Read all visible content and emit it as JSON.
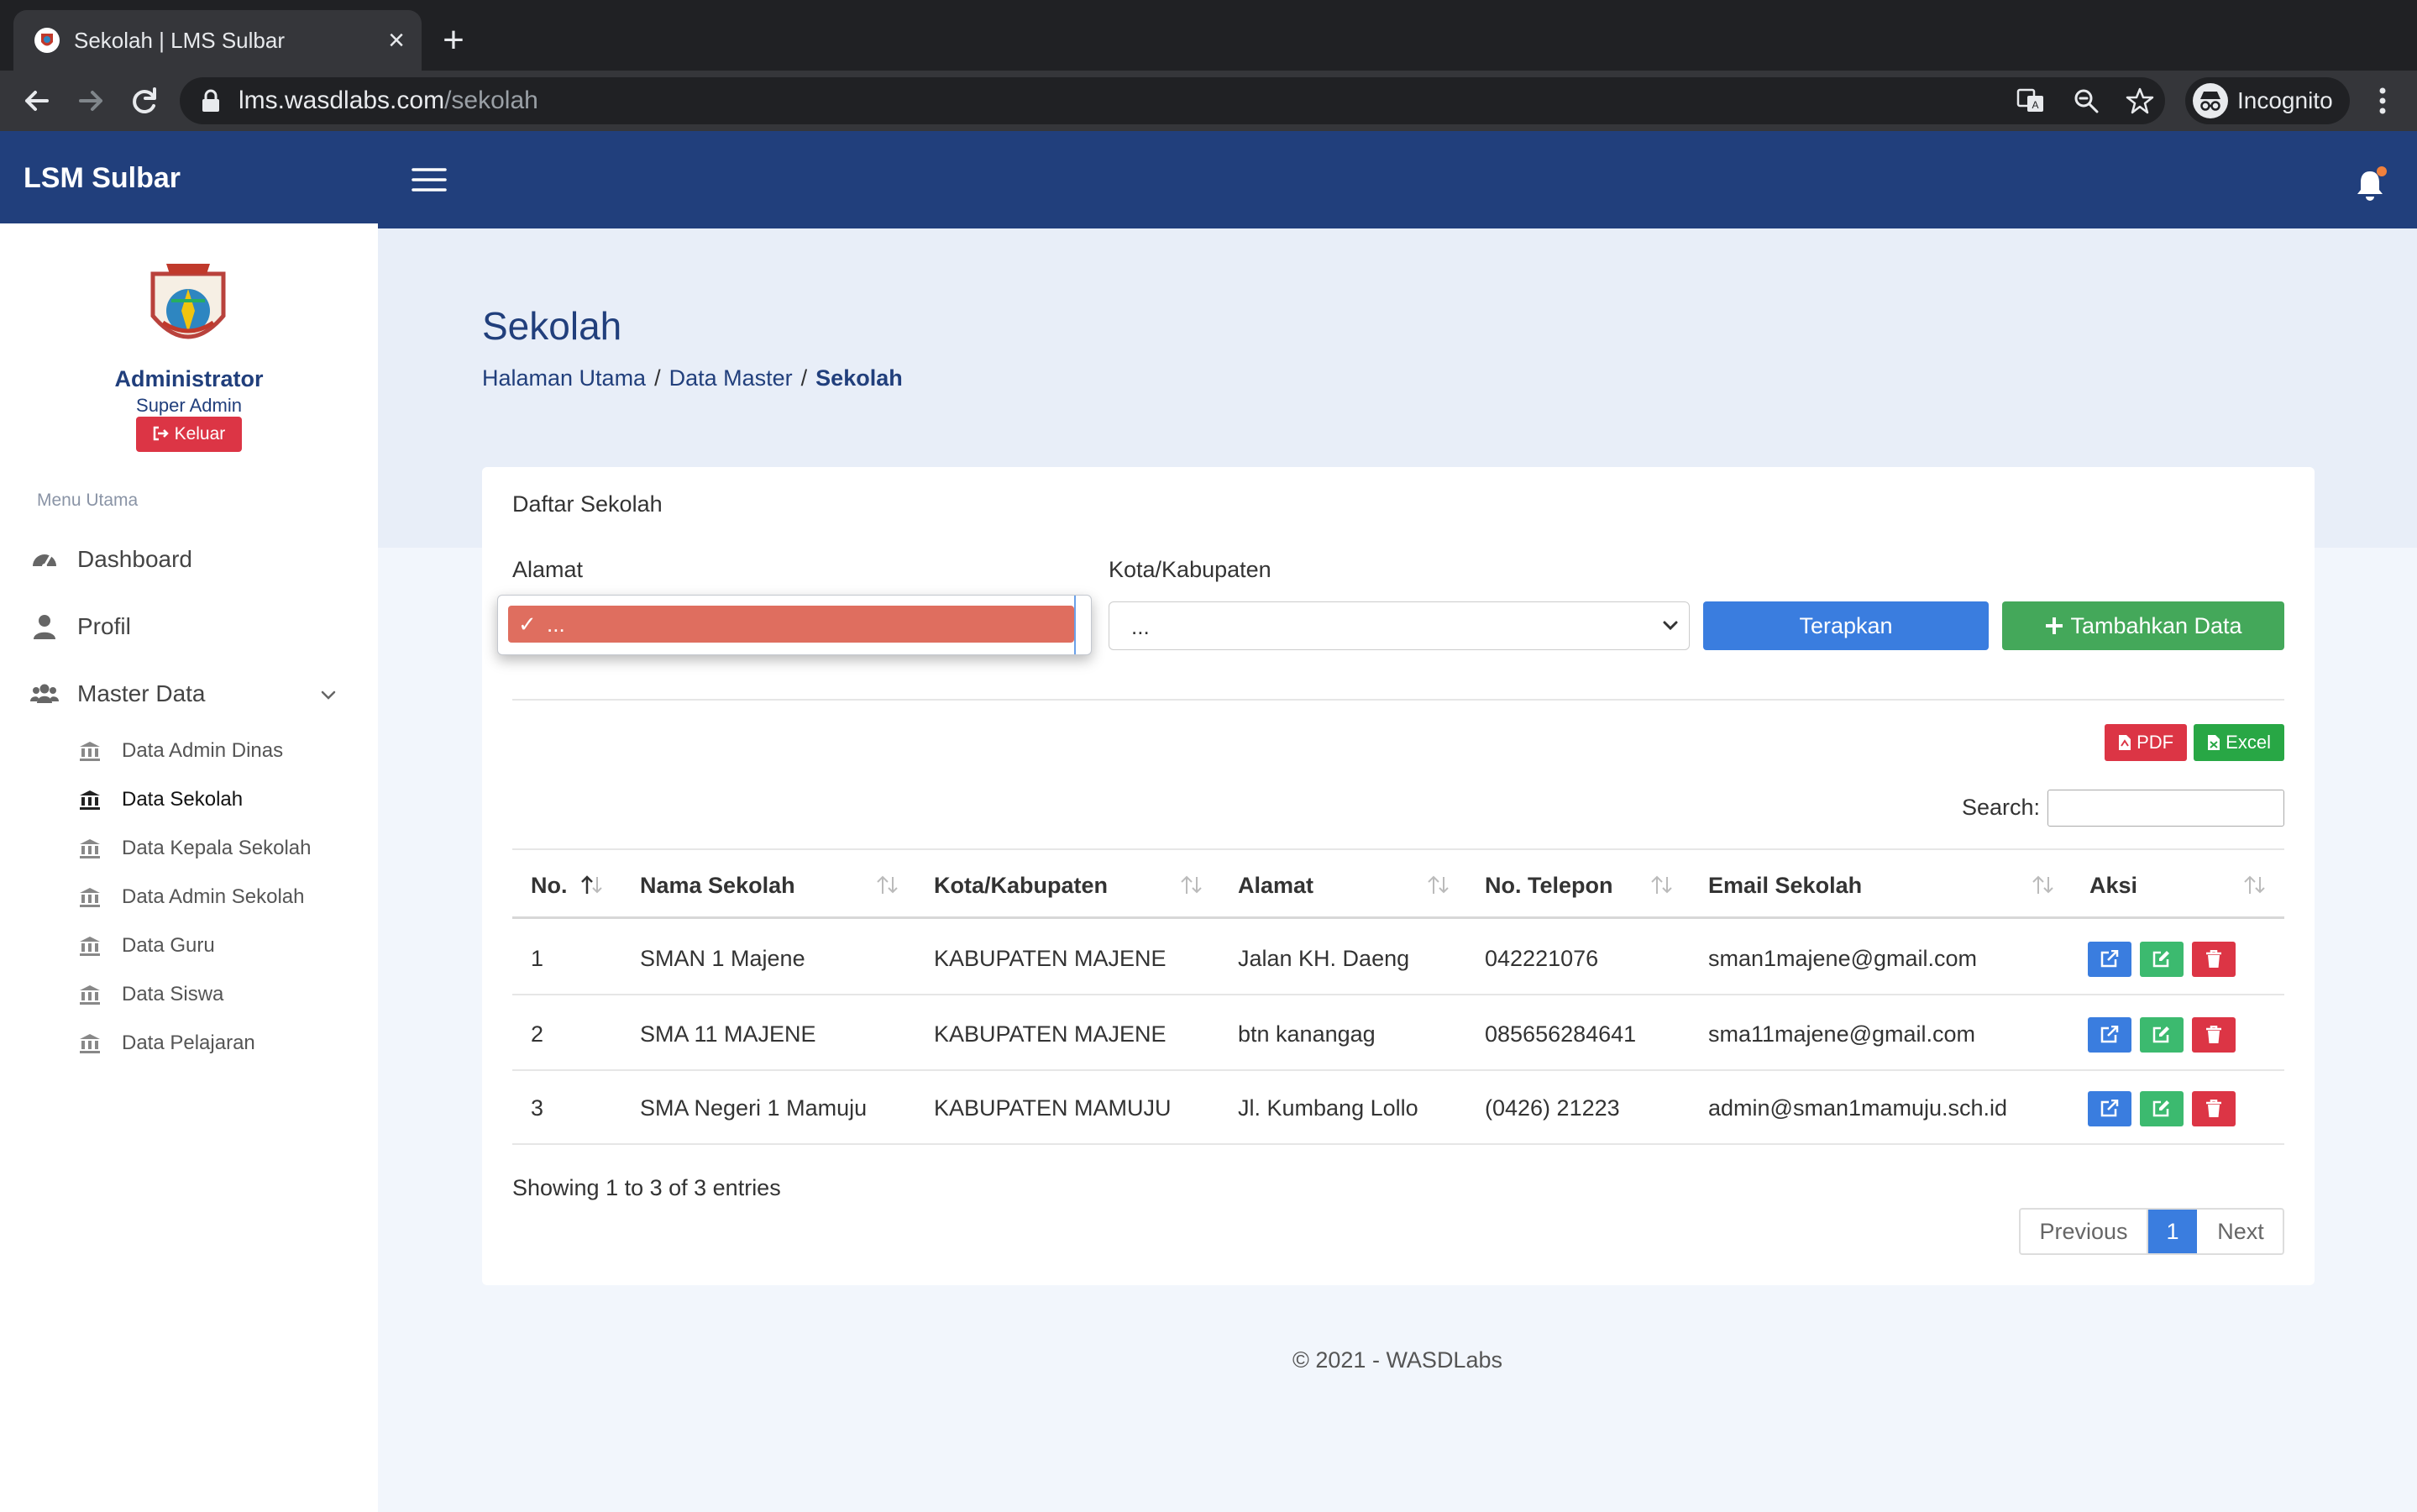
{
  "browser": {
    "tab_title": "Sekolah | LMS Sulbar",
    "url_host": "lms.wasdlabs.com",
    "url_path": "/sekolah",
    "incognito_label": "Incognito"
  },
  "header": {
    "brand": "LSM Sulbar"
  },
  "sidebar": {
    "profile_name": "Administrator",
    "profile_role": "Super Admin",
    "logout_label": "Keluar",
    "menu_heading": "Menu Utama",
    "items": [
      {
        "label": "Dashboard",
        "icon": "dashboard-icon"
      },
      {
        "label": "Profil",
        "icon": "user-icon"
      },
      {
        "label": "Master Data",
        "icon": "users-icon"
      }
    ],
    "subitems": [
      {
        "label": "Data Admin Dinas"
      },
      {
        "label": "Data Sekolah"
      },
      {
        "label": "Data Kepala Sekolah"
      },
      {
        "label": "Data Admin Sekolah"
      },
      {
        "label": "Data Guru"
      },
      {
        "label": "Data Siswa"
      },
      {
        "label": "Data Pelajaran"
      }
    ]
  },
  "page": {
    "title": "Sekolah",
    "breadcrumb": [
      "Halaman Utama",
      "Data Master",
      "Sekolah"
    ]
  },
  "card": {
    "title": "Daftar Sekolah",
    "filter_alamat_label": "Alamat",
    "filter_alamat_option": "...",
    "filter_kota_label": "Kota/Kabupaten",
    "filter_kota_value": "...",
    "apply_label": "Terapkan",
    "add_label": "Tambahkan Data",
    "pdf_label": "PDF",
    "excel_label": "Excel",
    "search_label": "Search:",
    "columns": [
      "No.",
      "Nama Sekolah",
      "Kota/Kabupaten",
      "Alamat",
      "No. Telepon",
      "Email Sekolah",
      "Aksi"
    ],
    "rows": [
      [
        "1",
        "SMAN 1 Majene",
        "KABUPATEN MAJENE",
        "Jalan KH. Daeng",
        "042221076",
        "sman1majene@gmail.com"
      ],
      [
        "2",
        "SMA 11 MAJENE",
        "KABUPATEN MAJENE",
        "btn kanangag",
        "085656284641",
        "sma11majene@gmail.com"
      ],
      [
        "3",
        "SMA Negeri 1 Mamuju",
        "KABUPATEN MAMUJU",
        "Jl. Kumbang Lollo",
        "(0426) 21223",
        "admin@sman1mamuju.sch.id"
      ]
    ],
    "info": "Showing 1 to 3 of 3 entries",
    "pagination": {
      "previous": "Previous",
      "current": "1",
      "next": "Next"
    }
  },
  "footer": "© 2021 - WASDLabs",
  "colors": {
    "primary": "#213f7c",
    "apply": "#3a7ddf",
    "add": "#44a85a",
    "danger": "#dc3545",
    "selected_option": "#df6e5f"
  }
}
